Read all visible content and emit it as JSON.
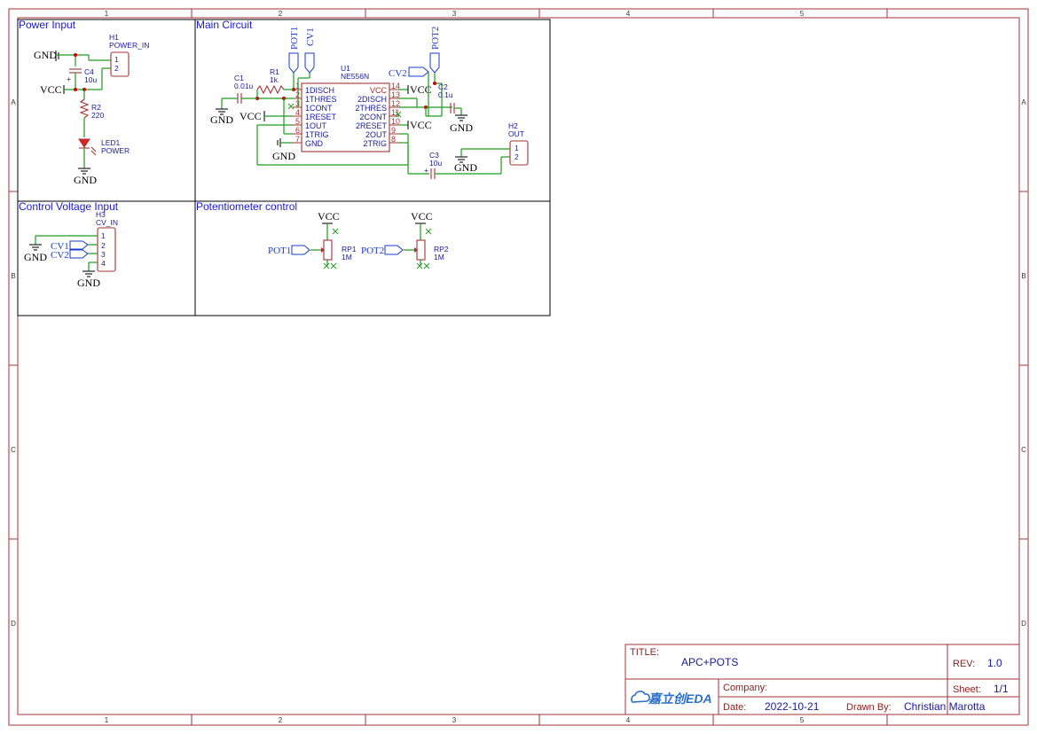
{
  "grid": {
    "columns": [
      "1",
      "2",
      "3",
      "4",
      "5"
    ],
    "rows": [
      "A",
      "B",
      "C",
      "D"
    ]
  },
  "sections": {
    "power_input": "Power Input",
    "main_circuit": "Main Circuit",
    "control_voltage_input": "Control Voltage Input",
    "potentiometer_control": "Potentiometer control"
  },
  "power_input": {
    "gnd_top": "GND",
    "vcc": "VCC",
    "gnd_bottom": "GND",
    "h1_ref": "H1",
    "h1_value": "POWER_IN",
    "h1_pins": [
      "1",
      "2"
    ],
    "c4_ref": "C4",
    "c4_value": "10u",
    "c4_plus": "+",
    "r2_ref": "R2",
    "r2_value": "220",
    "led1_ref": "LED1",
    "led1_value": "POWER"
  },
  "main_circuit": {
    "u1_ref": "U1",
    "u1_value": "NE556N",
    "left_pins": [
      {
        "num": "1",
        "name": "1DISCH"
      },
      {
        "num": "2",
        "name": "1THRES"
      },
      {
        "num": "3",
        "name": "1CONT"
      },
      {
        "num": "4",
        "name": "1RESET"
      },
      {
        "num": "5",
        "name": "1OUT"
      },
      {
        "num": "6",
        "name": "1TRIG"
      },
      {
        "num": "7",
        "name": "GND"
      }
    ],
    "right_pins": [
      {
        "num": "14",
        "name": "VCC"
      },
      {
        "num": "13",
        "name": "2DISCH"
      },
      {
        "num": "12",
        "name": "2THRES"
      },
      {
        "num": "11",
        "name": "2CONT"
      },
      {
        "num": "10",
        "name": "2RESET"
      },
      {
        "num": "9",
        "name": "2OUT"
      },
      {
        "num": "8",
        "name": "2TRIG"
      }
    ],
    "c1_ref": "C1",
    "c1_value": "0.01u",
    "r1_ref": "R1",
    "r1_value": "1k",
    "c2_ref": "C2",
    "c2_value": "0.1u",
    "c3_ref": "C3",
    "c3_value": "10u",
    "c3_plus": "+",
    "h2_ref": "H2",
    "h2_value": "OUT",
    "h2_pins": [
      "1",
      "2"
    ],
    "pot1_flag": "POT1",
    "cv1_flag": "CV1",
    "pot2_flag": "POT2",
    "cv2_flag": "CV2",
    "gnd_c1": "GND",
    "vcc_left": "VCC",
    "gnd_u1": "GND",
    "vcc_r1": "VCC",
    "vcc_r2": "VCC",
    "gnd_c2": "GND",
    "gnd_h2": "GND"
  },
  "control_voltage_input": {
    "h3_ref": "H3",
    "h3_value": "CV_IN",
    "h3_pins": [
      "1",
      "2",
      "3",
      "4"
    ],
    "gnd_left": "GND",
    "cv1_flag": "CV1",
    "cv2_flag": "CV2",
    "gnd_bottom": "GND"
  },
  "potentiometer_control": {
    "vcc1": "VCC",
    "vcc2": "VCC",
    "pot1_flag": "POT1",
    "pot2_flag": "POT2",
    "rp1_ref": "RP1",
    "rp1_value": "1M",
    "rp2_ref": "RP2",
    "rp2_value": "1M"
  },
  "title_block": {
    "title_label": "TITLE:",
    "title_value": "APC+POTS",
    "rev_label": "REV:",
    "rev_value": "1.0",
    "company_label": "Company:",
    "company_value": "",
    "sheet_label": "Sheet:",
    "sheet_value": "1/1",
    "date_label": "Date:",
    "date_value": "2022-10-21",
    "drawn_label": "Drawn By:",
    "drawn_value": "Christian Marotta",
    "logo_text": "嘉立创EDA"
  },
  "colors": {
    "frame": "#a33333",
    "wire": "#1e9a1e",
    "section_title": "#1a1acc",
    "net_flag": "#1a3acc"
  }
}
